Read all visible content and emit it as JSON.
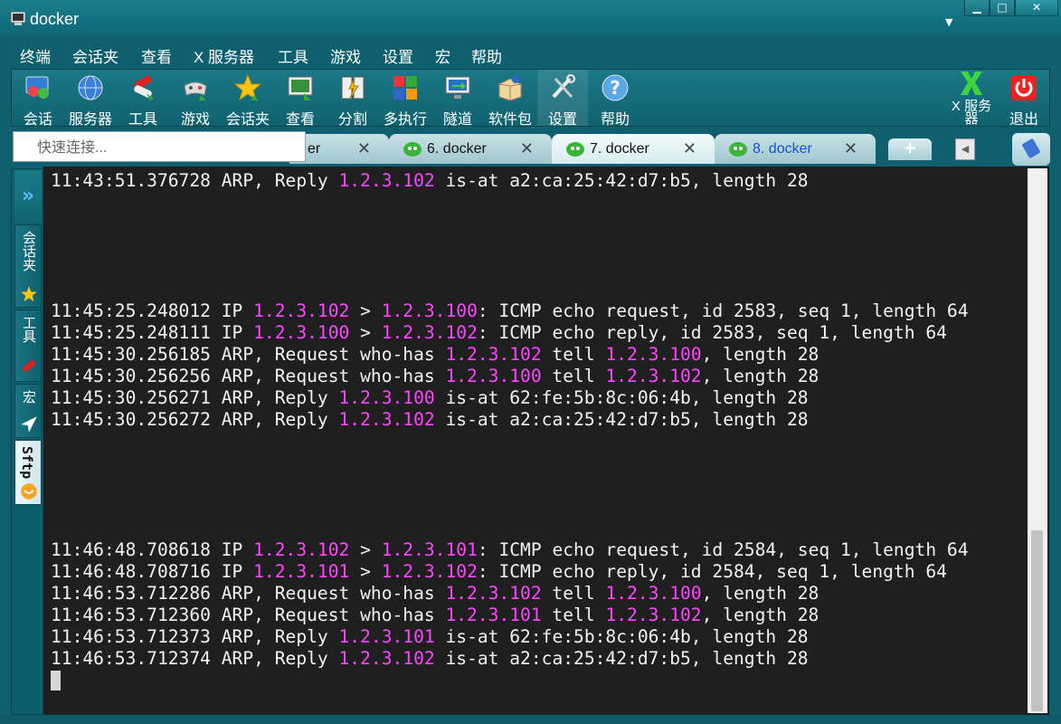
{
  "window": {
    "title": "docker"
  },
  "menu": [
    "终端",
    "会话夹",
    "查看",
    "X 服务器",
    "工具",
    "游戏",
    "设置",
    "宏",
    "帮助"
  ],
  "toolbar": {
    "items": [
      {
        "label": "会话",
        "icon": "sessions-icon"
      },
      {
        "label": "服务器",
        "icon": "servers-icon"
      },
      {
        "label": "工具",
        "icon": "tools-icon"
      },
      {
        "label": "游戏",
        "icon": "games-icon"
      },
      {
        "label": "会话夹",
        "icon": "star-icon"
      },
      {
        "label": "查看",
        "icon": "view-icon"
      },
      {
        "label": "分割",
        "icon": "split-icon"
      },
      {
        "label": "多执行",
        "icon": "multiexec-icon"
      },
      {
        "label": "隧道",
        "icon": "tunnel-icon"
      },
      {
        "label": "软件包",
        "icon": "packages-icon"
      },
      {
        "label": "设置",
        "icon": "settings-icon"
      },
      {
        "label": "帮助",
        "icon": "help-icon"
      }
    ],
    "xserver": "X 服务器",
    "exit": "退出"
  },
  "quick_connect": {
    "placeholder": "快速连接..."
  },
  "tabs": [
    {
      "label": "er",
      "partial": true
    },
    {
      "label": "6. docker"
    },
    {
      "label": "7. docker",
      "active": true
    },
    {
      "label": "8. docker",
      "color": "#1650d8"
    }
  ],
  "sidebar": {
    "tabs": [
      {
        "label": "会话夹",
        "icon": "star-icon"
      },
      {
        "label": "工具",
        "icon": "tools-icon"
      },
      {
        "label": "宏",
        "icon": "macro-icon"
      },
      {
        "label": "Sftp",
        "icon": "sftp-icon",
        "active": true
      }
    ]
  },
  "terminal": {
    "highlight_color": "#ff44ff",
    "lines": [
      [
        [
          "11:43:51.376728 ARP, Reply ",
          false
        ],
        [
          "1.2.3.102",
          true
        ],
        [
          " is-at a2:ca:25:42:d7:b5, length 28",
          false
        ]
      ],
      [],
      [],
      [],
      [],
      [],
      [
        [
          "11:45:25.248012 IP ",
          false
        ],
        [
          "1.2.3.102",
          true
        ],
        [
          " > ",
          false
        ],
        [
          "1.2.3.100",
          true
        ],
        [
          ": ICMP echo request, id 2583, seq 1, length 64",
          false
        ]
      ],
      [
        [
          "11:45:25.248111 IP ",
          false
        ],
        [
          "1.2.3.100",
          true
        ],
        [
          " > ",
          false
        ],
        [
          "1.2.3.102",
          true
        ],
        [
          ": ICMP echo reply, id 2583, seq 1, length 64",
          false
        ]
      ],
      [
        [
          "11:45:30.256185 ARP, Request who-has ",
          false
        ],
        [
          "1.2.3.102",
          true
        ],
        [
          " tell ",
          false
        ],
        [
          "1.2.3.100",
          true
        ],
        [
          ", length 28",
          false
        ]
      ],
      [
        [
          "11:45:30.256256 ARP, Request who-has ",
          false
        ],
        [
          "1.2.3.100",
          true
        ],
        [
          " tell ",
          false
        ],
        [
          "1.2.3.102",
          true
        ],
        [
          ", length 28",
          false
        ]
      ],
      [
        [
          "11:45:30.256271 ARP, Reply ",
          false
        ],
        [
          "1.2.3.100",
          true
        ],
        [
          " is-at 62:fe:5b:8c:06:4b, length 28",
          false
        ]
      ],
      [
        [
          "11:45:30.256272 ARP, Reply ",
          false
        ],
        [
          "1.2.3.102",
          true
        ],
        [
          " is-at a2:ca:25:42:d7:b5, length 28",
          false
        ]
      ],
      [],
      [],
      [],
      [],
      [],
      [
        [
          "11:46:48.708618 IP ",
          false
        ],
        [
          "1.2.3.102",
          true
        ],
        [
          " > ",
          false
        ],
        [
          "1.2.3.101",
          true
        ],
        [
          ": ICMP echo request, id 2584, seq 1, length 64",
          false
        ]
      ],
      [
        [
          "11:46:48.708716 IP ",
          false
        ],
        [
          "1.2.3.101",
          true
        ],
        [
          " > ",
          false
        ],
        [
          "1.2.3.102",
          true
        ],
        [
          ": ICMP echo reply, id 2584, seq 1, length 64",
          false
        ]
      ],
      [
        [
          "11:46:53.712286 ARP, Request who-has ",
          false
        ],
        [
          "1.2.3.102",
          true
        ],
        [
          " tell ",
          false
        ],
        [
          "1.2.3.100",
          true
        ],
        [
          ", length 28",
          false
        ]
      ],
      [
        [
          "11:46:53.712360 ARP, Request who-has ",
          false
        ],
        [
          "1.2.3.101",
          true
        ],
        [
          " tell ",
          false
        ],
        [
          "1.2.3.102",
          true
        ],
        [
          ", length 28",
          false
        ]
      ],
      [
        [
          "11:46:53.712373 ARP, Reply ",
          false
        ],
        [
          "1.2.3.101",
          true
        ],
        [
          " is-at 62:fe:5b:8c:06:4b, length 28",
          false
        ]
      ],
      [
        [
          "11:46:53.712374 ARP, Reply ",
          false
        ],
        [
          "1.2.3.102",
          true
        ],
        [
          " is-at a2:ca:25:42:d7:b5, length 28",
          false
        ]
      ]
    ]
  }
}
